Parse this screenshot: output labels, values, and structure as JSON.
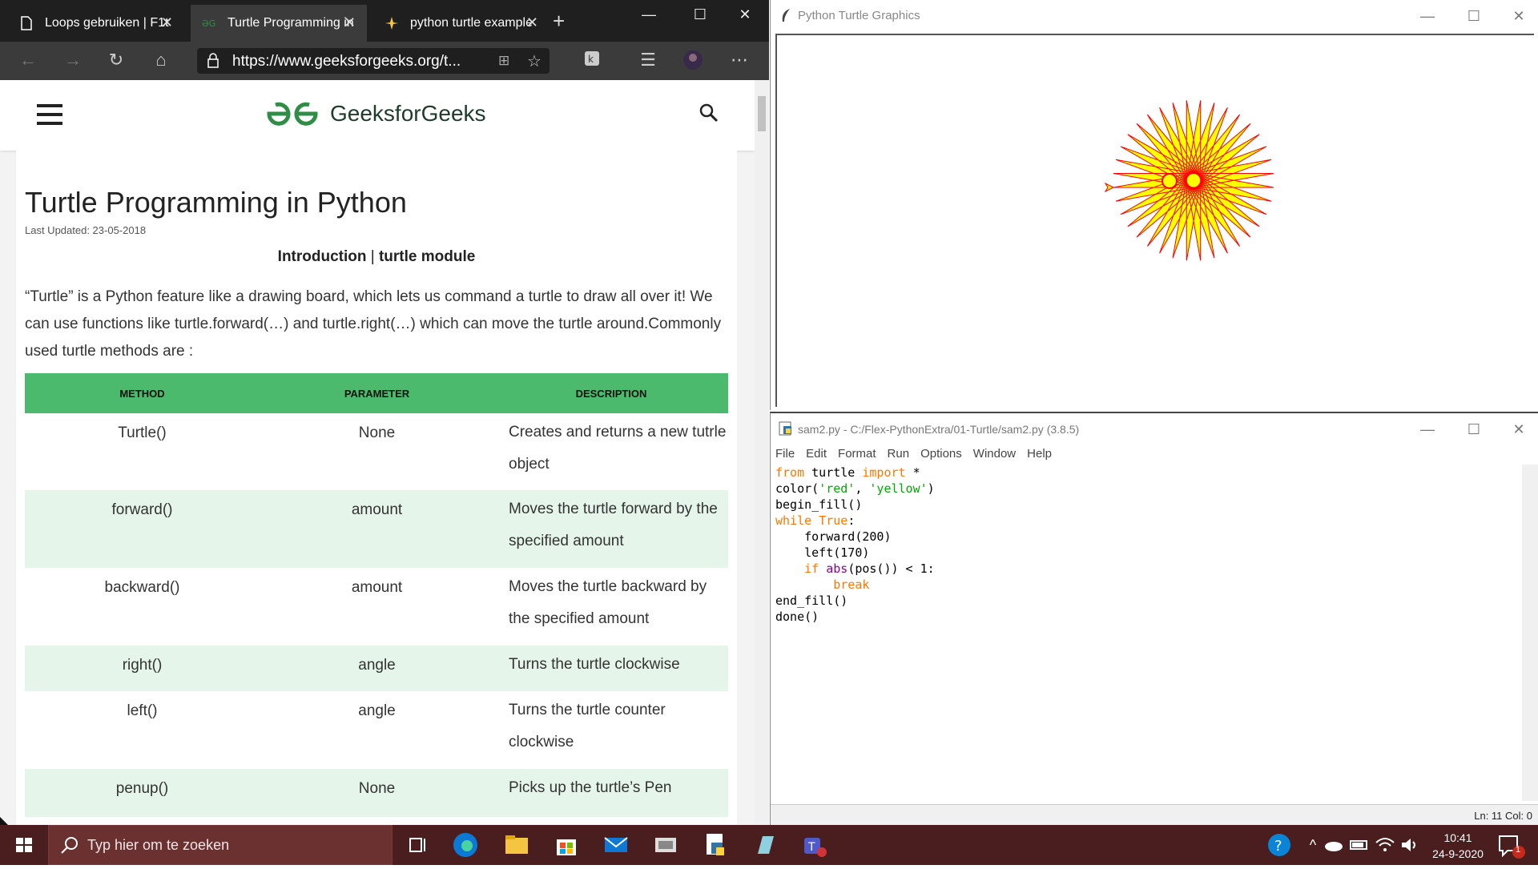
{
  "browser": {
    "tabs": [
      {
        "label": "Loops gebruiken | F1t",
        "active": false
      },
      {
        "label": "Turtle Programming in",
        "active": true
      },
      {
        "label": "python turtle example",
        "active": false
      }
    ],
    "url": "https://www.geeksforgeeks.org/t..."
  },
  "site": {
    "name": "GeeksforGeeks",
    "brand_color": "#2f8d46"
  },
  "article": {
    "title": "Turtle Programming in Python",
    "updated": "Last Updated: 23-05-2018",
    "subhead_left": "Introduction",
    "subhead_sep": " | ",
    "subhead_right": "turtle module",
    "intro": "“Turtle” is a Python feature like a drawing board, which lets us command a turtle to draw all over it! We can use functions like turtle.forward(…) and turtle.right(…) which can move the turtle around.Commonly used turtle methods are :",
    "table": {
      "headers": [
        "METHOD",
        "PARAMETER",
        "DESCRIPTION"
      ],
      "rows": [
        [
          "Turtle()",
          "None",
          "Creates and returns a new tutrle object"
        ],
        [
          "forward()",
          "amount",
          "Moves the turtle forward by the specified amount"
        ],
        [
          "backward()",
          "amount",
          "Moves the turtle backward by the specified amount"
        ],
        [
          "right()",
          "angle",
          "Turns the turtle clockwise"
        ],
        [
          "left()",
          "angle",
          "Turns the turtle counter clockwise"
        ],
        [
          "penup()",
          "None",
          "Picks up the turtle’s Pen"
        ]
      ]
    }
  },
  "turtle_window": {
    "title": "Python Turtle Graphics",
    "pen_color": "#ff0000",
    "fill_color": "#ffff00"
  },
  "idle": {
    "title": "sam2.py - C:/Flex-PythonExtra/01-Turtle/sam2.py (3.8.5)",
    "menu": [
      "File",
      "Edit",
      "Format",
      "Run",
      "Options",
      "Window",
      "Help"
    ],
    "status": "Ln: 11   Col: 0"
  },
  "taskbar": {
    "search_placeholder": "Typ hier om te zoeken",
    "time": "10:41",
    "date": "24-9-2020",
    "notification_count": "1"
  }
}
